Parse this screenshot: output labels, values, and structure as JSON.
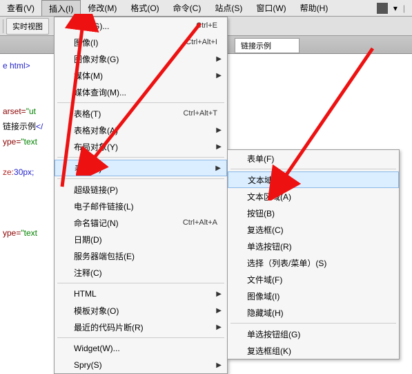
{
  "menubar": {
    "items": [
      {
        "label": "查看(V)"
      },
      {
        "label": "插入(I)"
      },
      {
        "label": "修改(M)"
      },
      {
        "label": "格式(O)"
      },
      {
        "label": "命令(C)"
      },
      {
        "label": "站点(S)"
      },
      {
        "label": "窗口(W)"
      },
      {
        "label": "帮助(H)"
      }
    ]
  },
  "toolbar": {
    "realtime_label": "实时视图"
  },
  "doc_title": "链接示例",
  "editor": {
    "line1": "e html>",
    "line2a": "arset=",
    "line2b": "\"ut",
    "line3a": "链接示例",
    "line3b": "</",
    "line4a": "ype=",
    "line4b": "\"text",
    "line5a": "ze:",
    "line5b": "30px;",
    "line6a": "ype=",
    "line6b": "\"text"
  },
  "insert_menu": {
    "items": [
      {
        "label": "标签(G)...",
        "shortcut": "Ctrl+E"
      },
      {
        "label": "图像(I)",
        "shortcut": "Ctrl+Alt+I"
      },
      {
        "label": "图像对象(G)",
        "submenu": true
      },
      {
        "label": "媒体(M)",
        "submenu": true
      },
      {
        "label": "媒体查询(M)..."
      },
      {
        "sep": true
      },
      {
        "label": "表格(T)",
        "shortcut": "Ctrl+Alt+T"
      },
      {
        "label": "表格对象(A)",
        "submenu": true
      },
      {
        "label": "布局对象(Y)",
        "submenu": true
      },
      {
        "sep": true
      },
      {
        "label": "表单(F)",
        "submenu": true,
        "highlight": true
      },
      {
        "sep": true
      },
      {
        "label": "超级链接(P)"
      },
      {
        "label": "电子邮件链接(L)"
      },
      {
        "label": "命名锚记(N)",
        "shortcut": "Ctrl+Alt+A"
      },
      {
        "label": "日期(D)"
      },
      {
        "label": "服务器端包括(E)"
      },
      {
        "label": "注释(C)"
      },
      {
        "sep": true
      },
      {
        "label": "HTML",
        "submenu": true
      },
      {
        "label": "模板对象(O)",
        "submenu": true
      },
      {
        "label": "最近的代码片断(R)",
        "submenu": true
      },
      {
        "sep": true
      },
      {
        "label": "Widget(W)..."
      },
      {
        "label": "Spry(S)",
        "submenu": true
      }
    ]
  },
  "form_submenu": {
    "items": [
      {
        "label": "表单(F)"
      },
      {
        "sep": true
      },
      {
        "label": "文本域(T)",
        "highlight": true
      },
      {
        "label": "文本区域(A)"
      },
      {
        "label": "按钮(B)"
      },
      {
        "label": "复选框(C)"
      },
      {
        "label": "单选按钮(R)"
      },
      {
        "label": "选择（列表/菜单）(S)"
      },
      {
        "label": "文件域(F)"
      },
      {
        "label": "图像域(I)"
      },
      {
        "label": "隐藏域(H)"
      },
      {
        "sep": true
      },
      {
        "label": "单选按钮组(G)"
      },
      {
        "label": "复选框组(K)"
      }
    ]
  }
}
